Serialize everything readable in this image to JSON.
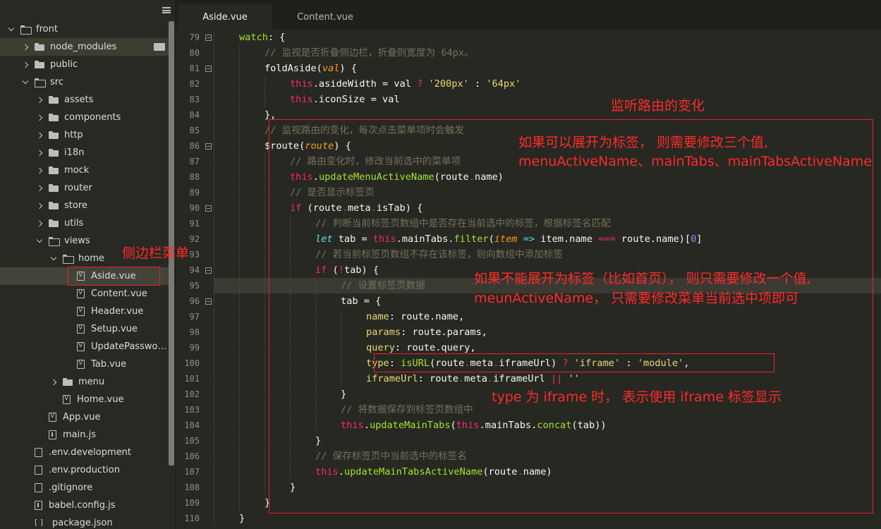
{
  "sidebar": {
    "root": "front",
    "items": [
      {
        "label": "node_modules",
        "depth": 1,
        "kind": "folder",
        "state": "collapsed",
        "hl": true,
        "badge": true
      },
      {
        "label": "public",
        "depth": 1,
        "kind": "folder",
        "state": "collapsed"
      },
      {
        "label": "src",
        "depth": 1,
        "kind": "folder",
        "state": "expanded"
      },
      {
        "label": "assets",
        "depth": 2,
        "kind": "folder",
        "state": "collapsed"
      },
      {
        "label": "components",
        "depth": 2,
        "kind": "folder",
        "state": "collapsed"
      },
      {
        "label": "http",
        "depth": 2,
        "kind": "folder",
        "state": "collapsed"
      },
      {
        "label": "i18n",
        "depth": 2,
        "kind": "folder",
        "state": "collapsed"
      },
      {
        "label": "mock",
        "depth": 2,
        "kind": "folder",
        "state": "collapsed"
      },
      {
        "label": "router",
        "depth": 2,
        "kind": "folder",
        "state": "collapsed"
      },
      {
        "label": "store",
        "depth": 2,
        "kind": "folder",
        "state": "collapsed"
      },
      {
        "label": "utils",
        "depth": 2,
        "kind": "folder",
        "state": "collapsed"
      },
      {
        "label": "views",
        "depth": 2,
        "kind": "folder",
        "state": "expanded"
      },
      {
        "label": "home",
        "depth": 3,
        "kind": "folder",
        "state": "expanded"
      },
      {
        "label": "Aside.vue",
        "depth": 4,
        "kind": "vue",
        "sel": true
      },
      {
        "label": "Content.vue",
        "depth": 4,
        "kind": "vue"
      },
      {
        "label": "Header.vue",
        "depth": 4,
        "kind": "vue"
      },
      {
        "label": "Setup.vue",
        "depth": 4,
        "kind": "vue"
      },
      {
        "label": "UpdatePasswor...",
        "depth": 4,
        "kind": "vue"
      },
      {
        "label": "Tab.vue",
        "depth": 4,
        "kind": "vue"
      },
      {
        "label": "menu",
        "depth": 3,
        "kind": "folder",
        "state": "collapsed"
      },
      {
        "label": "Home.vue",
        "depth": 3,
        "kind": "vue"
      },
      {
        "label": "App.vue",
        "depth": 2,
        "kind": "vue"
      },
      {
        "label": "main.js",
        "depth": 2,
        "kind": "js"
      },
      {
        "label": ".env.development",
        "depth": 1,
        "kind": "file"
      },
      {
        "label": ".env.production",
        "depth": 1,
        "kind": "file"
      },
      {
        "label": ".gitignore",
        "depth": 1,
        "kind": "file"
      },
      {
        "label": "babel.config.js",
        "depth": 1,
        "kind": "js"
      },
      {
        "label": "package.json",
        "depth": 1,
        "kind": "json"
      }
    ]
  },
  "tabs": [
    {
      "label": "Aside.vue",
      "active": true
    },
    {
      "label": "Content.vue",
      "active": false
    }
  ],
  "code": [
    {
      "n": 79,
      "fold": true,
      "ind": 1,
      "tokens": [
        [
          "watch",
          "f"
        ],
        [
          ": {",
          ""
        ]
      ]
    },
    {
      "n": 80,
      "ind": 2,
      "tokens": [
        [
          "// 监视是否折叠侧边栏，折叠则宽度为 64px。",
          "c"
        ]
      ]
    },
    {
      "n": 81,
      "fold": true,
      "ind": 2,
      "tokens": [
        [
          "foldAside",
          ""
        ],
        [
          "(",
          ""
        ],
        [
          "val",
          "p"
        ],
        [
          ") {",
          ""
        ]
      ]
    },
    {
      "n": 82,
      "ind": 3,
      "tokens": [
        [
          "this",
          "k"
        ],
        [
          ".asideWidth = val ",
          ""
        ],
        [
          "?",
          "k"
        ],
        [
          " ",
          ""
        ],
        [
          "'200px'",
          "s"
        ],
        [
          " : ",
          ""
        ],
        [
          "'64px'",
          "s"
        ]
      ]
    },
    {
      "n": 83,
      "ind": 3,
      "tokens": [
        [
          "this",
          "k"
        ],
        [
          ".iconSize = val",
          ""
        ]
      ]
    },
    {
      "n": 84,
      "ind": 2,
      "tokens": [
        [
          "},",
          ""
        ]
      ]
    },
    {
      "n": 85,
      "ind": 2,
      "tokens": [
        [
          "// 监视路由的变化，每次点击菜单项时会触发",
          "c"
        ]
      ]
    },
    {
      "n": 86,
      "fold": true,
      "ind": 2,
      "tokens": [
        [
          "$route",
          ""
        ],
        [
          "(",
          ""
        ],
        [
          "route",
          "p"
        ],
        [
          ") {",
          ""
        ]
      ]
    },
    {
      "n": 87,
      "ind": 3,
      "tokens": [
        [
          "// 路由变化时，修改当前选中的菜单项",
          "c"
        ]
      ]
    },
    {
      "n": 88,
      "ind": 3,
      "tokens": [
        [
          "this",
          "k"
        ],
        [
          ".",
          ""
        ],
        [
          "updateMenuActiveName",
          "f"
        ],
        [
          "(route",
          ""
        ],
        [
          ".",
          "k"
        ],
        [
          "name)",
          ""
        ]
      ]
    },
    {
      "n": 89,
      "ind": 3,
      "tokens": [
        [
          "// 是否显示标签页",
          "c"
        ]
      ]
    },
    {
      "n": 90,
      "fold": true,
      "ind": 3,
      "tokens": [
        [
          "if",
          "k"
        ],
        [
          " (route",
          ""
        ],
        [
          ".",
          "k"
        ],
        [
          "meta",
          ""
        ],
        [
          ".",
          "k"
        ],
        [
          "isTab) {",
          ""
        ]
      ]
    },
    {
      "n": 91,
      "ind": 4,
      "tokens": [
        [
          "// 判断当前标签页数组中是否存在当前选中的标签，根据标签名匹配",
          "c"
        ]
      ]
    },
    {
      "n": 92,
      "ind": 4,
      "tokens": [
        [
          "let",
          "t"
        ],
        [
          " tab = ",
          ""
        ],
        [
          "this",
          "k"
        ],
        [
          ".mainTabs.",
          ""
        ],
        [
          "filter",
          "f"
        ],
        [
          "(",
          ""
        ],
        [
          "item",
          "p"
        ],
        [
          " ",
          ""
        ],
        [
          "=>",
          "v"
        ],
        [
          " item.name ",
          ""
        ],
        [
          "===",
          "k"
        ],
        [
          " route.name)[",
          ""
        ],
        [
          "0",
          "n"
        ],
        [
          "]",
          ""
        ]
      ]
    },
    {
      "n": 93,
      "ind": 4,
      "tokens": [
        [
          "// 若当前标签页数组不存在该标签，则向数组中添加标签",
          "c"
        ]
      ]
    },
    {
      "n": 94,
      "fold": true,
      "ind": 4,
      "tokens": [
        [
          "if",
          "k"
        ],
        [
          " (",
          ""
        ],
        [
          "!",
          "k"
        ],
        [
          "tab) {",
          ""
        ]
      ]
    },
    {
      "n": 95,
      "ind": 5,
      "cur": true,
      "tokens": [
        [
          "// 设置标签页数据",
          "c"
        ]
      ]
    },
    {
      "n": 96,
      "fold": true,
      "ind": 5,
      "tokens": [
        [
          "tab = {",
          ""
        ]
      ]
    },
    {
      "n": 97,
      "ind": 6,
      "tokens": [
        [
          "name",
          "s"
        ],
        [
          ": route.name,",
          ""
        ]
      ]
    },
    {
      "n": 98,
      "ind": 6,
      "tokens": [
        [
          "params",
          "s"
        ],
        [
          ": route.params,",
          ""
        ]
      ]
    },
    {
      "n": 99,
      "ind": 6,
      "tokens": [
        [
          "query",
          "s"
        ],
        [
          ": route.query,",
          ""
        ]
      ]
    },
    {
      "n": 100,
      "ind": 6,
      "tokens": [
        [
          "type",
          "s"
        ],
        [
          ": ",
          ""
        ],
        [
          "isURL",
          "f"
        ],
        [
          "(route",
          ""
        ],
        [
          ".",
          "k"
        ],
        [
          "meta",
          ""
        ],
        [
          ".",
          "k"
        ],
        [
          "iframeUrl) ",
          ""
        ],
        [
          "?",
          "k"
        ],
        [
          " ",
          ""
        ],
        [
          "'iframe'",
          "s"
        ],
        [
          " : ",
          ""
        ],
        [
          "'module'",
          "s"
        ],
        [
          ",",
          ""
        ]
      ]
    },
    {
      "n": 101,
      "ind": 6,
      "tokens": [
        [
          "iframeUrl",
          "s"
        ],
        [
          ": route",
          ""
        ],
        [
          ".",
          "k"
        ],
        [
          "meta",
          ""
        ],
        [
          ".",
          "k"
        ],
        [
          "iframeUrl ",
          ""
        ],
        [
          "||",
          "k"
        ],
        [
          " ",
          ""
        ],
        [
          "''",
          "s"
        ]
      ]
    },
    {
      "n": 102,
      "ind": 5,
      "tokens": [
        [
          "}",
          ""
        ]
      ]
    },
    {
      "n": 103,
      "ind": 5,
      "tokens": [
        [
          "// 将数据保存到标签页数组中",
          "c"
        ]
      ]
    },
    {
      "n": 104,
      "ind": 5,
      "tokens": [
        [
          "this",
          "k"
        ],
        [
          ".",
          ""
        ],
        [
          "updateMainTabs",
          "f"
        ],
        [
          "(",
          ""
        ],
        [
          "this",
          "k"
        ],
        [
          ".mainTabs.",
          ""
        ],
        [
          "concat",
          "f"
        ],
        [
          "(tab))",
          ""
        ]
      ]
    },
    {
      "n": 105,
      "ind": 4,
      "tokens": [
        [
          "}",
          ""
        ]
      ]
    },
    {
      "n": 106,
      "ind": 4,
      "tokens": [
        [
          "// 保存标签页中当前选中的标签名",
          "c"
        ]
      ]
    },
    {
      "n": 107,
      "ind": 4,
      "tokens": [
        [
          "this",
          "k"
        ],
        [
          ".",
          ""
        ],
        [
          "updateMainTabsActiveName",
          "f"
        ],
        [
          "(route",
          ""
        ],
        [
          ".",
          "k"
        ],
        [
          "name)",
          ""
        ]
      ]
    },
    {
      "n": 108,
      "ind": 3,
      "tokens": [
        [
          "}",
          ""
        ]
      ]
    },
    {
      "n": 109,
      "ind": 2,
      "tokens": [
        [
          "}",
          ""
        ]
      ]
    },
    {
      "n": 110,
      "ind": 1,
      "tokens": [
        [
          "}",
          ""
        ]
      ]
    }
  ],
  "annotations": {
    "watch_route": "监听路由的变化",
    "sidebar_menu": "侧边栏菜单",
    "tab_case_line1": "如果可以展开为标签， 则需要修改三个值,",
    "tab_case_line2": "menuActiveName、mainTabs、mainTabsActiveName",
    "non_tab_line1": "如果不能展开为标签（比如首页）， 则只需要修改一个值,",
    "non_tab_line2": "meunActiveName， 只需要修改菜单当前选中项即可",
    "iframe_note": "type 为 iframe 时， 表示使用 iframe 标签显示"
  },
  "colors": {
    "annotation_red": "#ff2a2a",
    "editor_bg": "#272822",
    "sidebar_bg": "#282923"
  }
}
